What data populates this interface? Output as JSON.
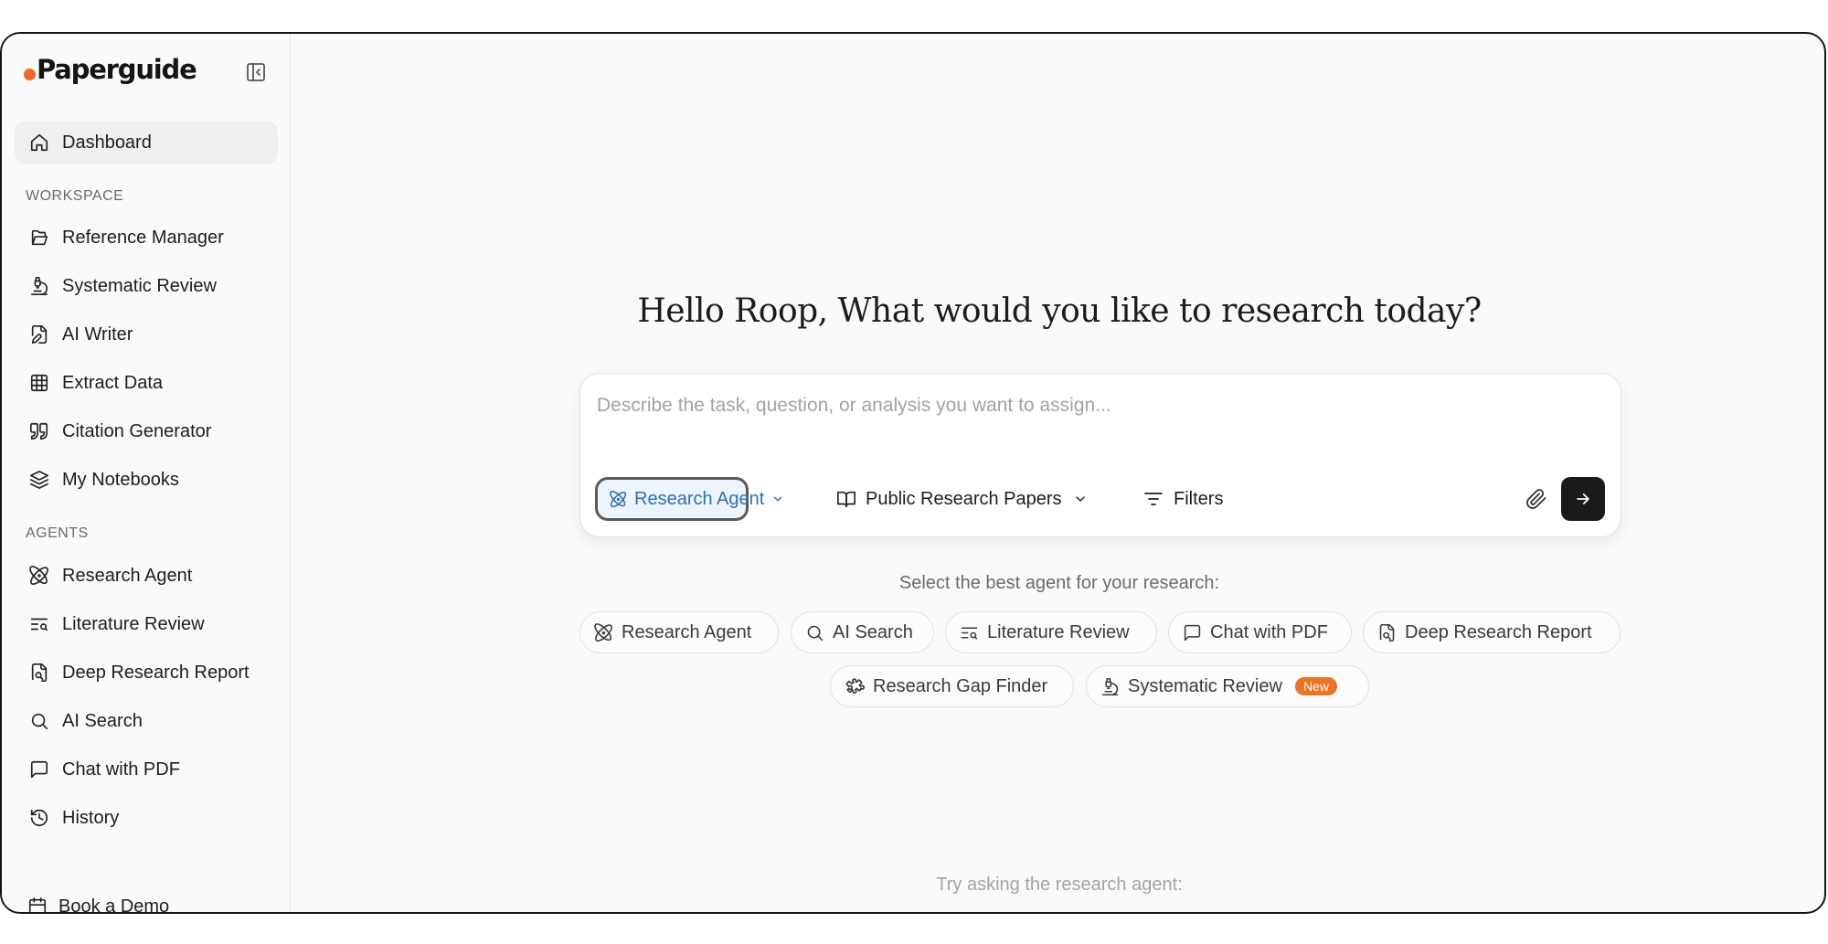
{
  "app": {
    "logo_text": "Paperguide",
    "brand_color": "#f06a1d"
  },
  "sidebar": {
    "dashboard": {
      "label": "Dashboard",
      "icon": "home-icon"
    },
    "workspace_label": "WORKSPACE",
    "workspace": [
      {
        "label": "Reference Manager",
        "icon": "folder-open-icon"
      },
      {
        "label": "Systematic Review",
        "icon": "microscope-icon"
      },
      {
        "label": "AI Writer",
        "icon": "file-pen-icon"
      },
      {
        "label": "Extract Data",
        "icon": "table-icon"
      },
      {
        "label": "Citation Generator",
        "icon": "quote-icon"
      },
      {
        "label": "My Notebooks",
        "icon": "layers-icon"
      }
    ],
    "agents_label": "AGENTS",
    "agents": [
      {
        "label": "Research Agent",
        "icon": "atom-icon"
      },
      {
        "label": "Literature Review",
        "icon": "text-search-icon"
      },
      {
        "label": "Deep Research Report",
        "icon": "file-search-icon"
      },
      {
        "label": "AI Search",
        "icon": "search-icon"
      },
      {
        "label": "Chat with PDF",
        "icon": "message-square-icon"
      },
      {
        "label": "History",
        "icon": "history-icon"
      }
    ],
    "book_demo": {
      "label": "Book a Demo",
      "icon": "calendar-icon"
    }
  },
  "main": {
    "greeting": "Hello Roop, What would you like to research today?",
    "input": {
      "placeholder": "Describe the task, question, or analysis you want to assign...",
      "value": ""
    },
    "agent_select": {
      "label": "Research Agent",
      "color": "#2f6fb7"
    },
    "source_select": {
      "label": "Public Research Papers"
    },
    "filters": {
      "label": "Filters"
    },
    "select_hint": "Select the best agent for your research:",
    "chips": [
      {
        "label": "Research Agent",
        "icon": "atom-icon"
      },
      {
        "label": "AI Search",
        "icon": "search-icon"
      },
      {
        "label": "Literature Review",
        "icon": "text-search-icon"
      },
      {
        "label": "Chat with PDF",
        "icon": "message-square-icon"
      },
      {
        "label": "Deep Research Report",
        "icon": "file-search-icon"
      },
      {
        "label": "Research Gap Finder",
        "icon": "puzzle-icon"
      },
      {
        "label": "Systematic Review",
        "icon": "microscope-icon",
        "badge": "New"
      }
    ],
    "try_hint": "Try asking the research agent:"
  }
}
